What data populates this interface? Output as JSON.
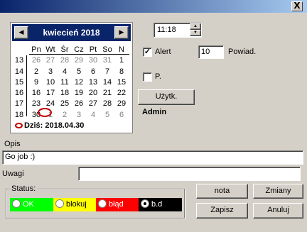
{
  "window": {
    "close_glyph": "X"
  },
  "calendar": {
    "month_year": "kwiecień 2018",
    "prev_glyph": "◀",
    "next_glyph": "▶",
    "day_headers": [
      "Pn",
      "Wt",
      "Śr",
      "Cz",
      "Pt",
      "So",
      "N"
    ],
    "weeks": [
      {
        "wk": "13",
        "days": [
          "26",
          "27",
          "28",
          "29",
          "30",
          "31",
          "1"
        ]
      },
      {
        "wk": "14",
        "days": [
          "2",
          "3",
          "4",
          "5",
          "6",
          "7",
          "8"
        ]
      },
      {
        "wk": "15",
        "days": [
          "9",
          "10",
          "11",
          "12",
          "13",
          "14",
          "15"
        ]
      },
      {
        "wk": "16",
        "days": [
          "16",
          "17",
          "18",
          "19",
          "20",
          "21",
          "22"
        ]
      },
      {
        "wk": "17",
        "days": [
          "23",
          "24",
          "25",
          "26",
          "27",
          "28",
          "29"
        ]
      },
      {
        "wk": "18",
        "days": [
          "30",
          "1",
          "2",
          "3",
          "4",
          "5",
          "6"
        ]
      }
    ],
    "today_label": "Dziś: 2018.04.30"
  },
  "time": {
    "value": "11:18"
  },
  "alert": {
    "checked": true,
    "label": "Alert",
    "count": "10",
    "count_label": "Powiad."
  },
  "p_option": {
    "checked": false,
    "label": "P."
  },
  "user": {
    "button_label": "Użytk.",
    "name": "Admin"
  },
  "opis": {
    "label": "Opis",
    "value": "Go job :)"
  },
  "uwagi": {
    "label": "Uwagi",
    "value": ""
  },
  "status": {
    "label": "Status:",
    "options": [
      {
        "label": "OK",
        "color": "#00ff00",
        "text_color": "#ffffff",
        "selected": false
      },
      {
        "label": "blokuj",
        "color": "#ffff00",
        "text_color": "#000000",
        "selected": false
      },
      {
        "label": "błąd",
        "color": "#ff0000",
        "text_color": "#ffffff",
        "selected": false
      },
      {
        "label": "b.d",
        "color": "#000000",
        "text_color": "#ffffff",
        "selected": true
      }
    ]
  },
  "buttons": {
    "nota": "nota",
    "zmiany": "Zmiany",
    "zapisz": "Zapisz",
    "anuluj": "Anuluj"
  }
}
